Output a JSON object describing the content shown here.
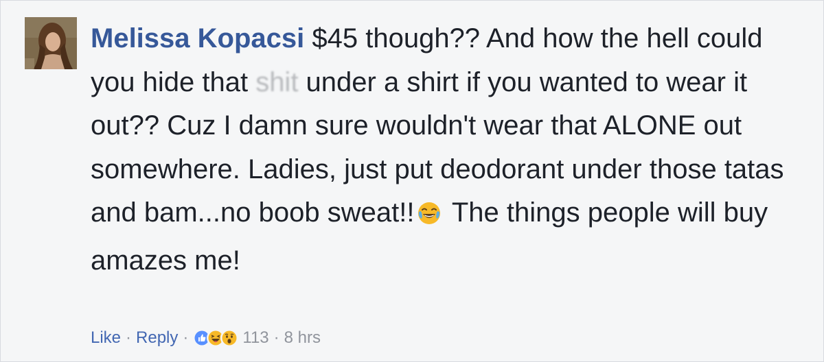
{
  "comment": {
    "author": "Melissa Kopacsi",
    "text_part1": " $45 though?? And how the hell could you hide that ",
    "censored_word": "shit",
    "text_part2": " under a shirt if you wanted to wear it out?? Cuz I damn sure wouldn't wear that ALONE out somewhere. Ladies, just put deodorant under those tatas and bam...no boob sweat!!",
    "emoji": "tears-of-joy-emoji",
    "text_part3": " The things people will buy amazes me!"
  },
  "actions": {
    "like_label": "Like",
    "separator": "·",
    "reply_label": "Reply",
    "reaction_icons": [
      "like-reaction-icon",
      "haha-reaction-icon",
      "wow-reaction-icon"
    ],
    "reaction_count": "113",
    "timestamp": "8 hrs"
  },
  "colors": {
    "background": "#f5f6f7",
    "author_link": "#365899",
    "action_link": "#4267b2",
    "meta_text": "#90949c",
    "body_text": "#1d2129",
    "like_blue": "#5890ff",
    "emoji_yellow": "#f7b928"
  }
}
